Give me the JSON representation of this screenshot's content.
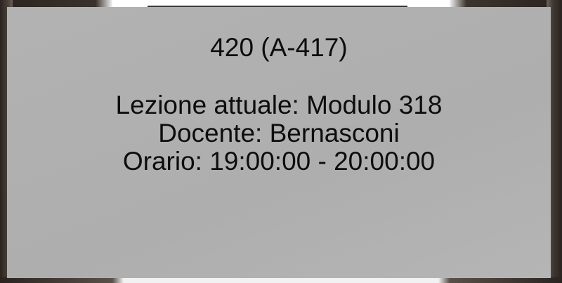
{
  "panel": {
    "room_title": "420 (A-417)",
    "current_lesson": "Lezione attuale: Modulo 318",
    "teacher": "Docente: Bernasconi",
    "schedule": "Orario: 19:00:00 - 20:00:00"
  }
}
